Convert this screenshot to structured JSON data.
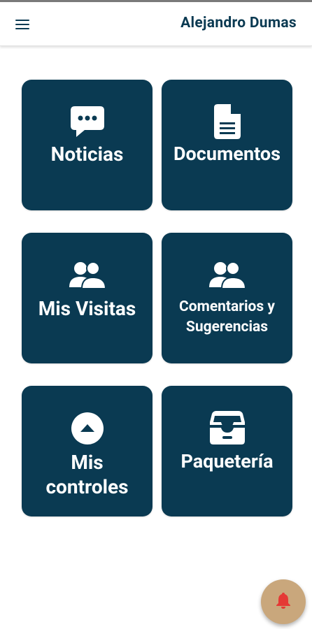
{
  "header": {
    "menu_icon": "menu-icon",
    "user_name": "Alejandro Dumas"
  },
  "tiles": [
    {
      "label": "Noticias",
      "icon": "chat-bubble-icon"
    },
    {
      "label": "Documentos",
      "icon": "document-icon"
    },
    {
      "label": "Mis Visitas",
      "icon": "users-icon"
    },
    {
      "label_line1": "Comentarios y",
      "label_line2": "Sugerencias",
      "icon": "users-icon"
    },
    {
      "label_line1": "Mis",
      "label_line2": "controles",
      "icon": "arrow-up-circle-icon"
    },
    {
      "label": "Paquetería",
      "icon": "inbox-tray-icon"
    }
  ],
  "fab": {
    "icon": "bell-icon"
  },
  "colors": {
    "tile_background": "#0a3a52",
    "tile_text": "#ffffff",
    "header_text": "#0b3a52",
    "fab_background": "#c9a77c",
    "bell": "#e53935"
  }
}
